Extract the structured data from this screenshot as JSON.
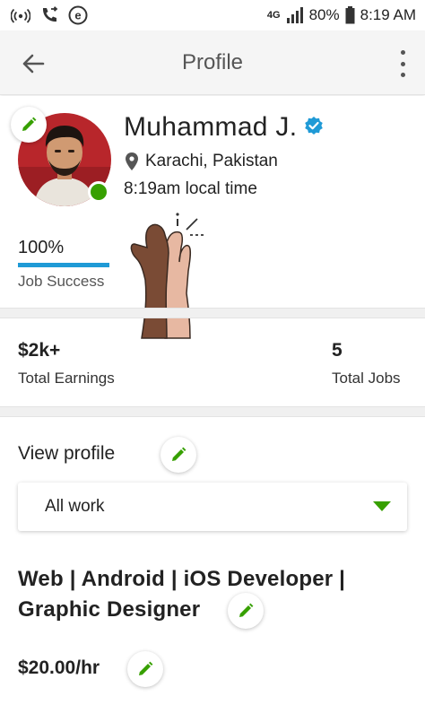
{
  "status_bar": {
    "network": "4G",
    "battery": "80%",
    "time": "8:19 AM",
    "icons": [
      "wifi-hotspot-icon",
      "call-forward-icon",
      "e-app-icon",
      "signal-icon",
      "battery-icon"
    ]
  },
  "app_bar": {
    "title": "Profile",
    "back_icon": "arrow-left-icon",
    "more_icon": "more-vertical-icon"
  },
  "profile": {
    "name": "Muhammad J.",
    "verified_icon": "verified-badge-icon",
    "location": "Karachi, Pakistan",
    "local_time": "8:19am local time",
    "online": true,
    "job_success": {
      "value": "100%",
      "percent": 100,
      "label": "Job Success"
    }
  },
  "stats": {
    "earnings": {
      "value": "$2k+",
      "label": "Total Earnings"
    },
    "jobs": {
      "value": "5",
      "label": "Total Jobs"
    }
  },
  "view_profile": {
    "label": "View profile",
    "selected": "All work"
  },
  "headline": {
    "line1": "Web | Android | iOS Developer |",
    "line2": "Graphic Designer"
  },
  "rate": "$20.00/hr",
  "colors": {
    "accent_green": "#37a000",
    "verified_blue": "#1f9ad6",
    "job_success_bar": "#1f9ad6"
  }
}
